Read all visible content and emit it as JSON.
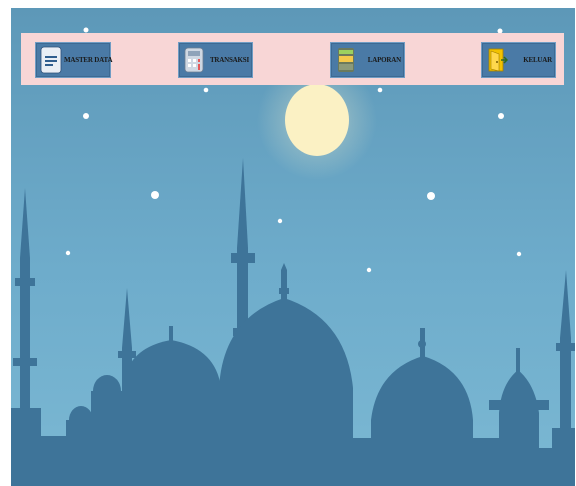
{
  "menu": {
    "master_data_label": "MASTER DATA",
    "transaksi_label": "TRANSAKSI",
    "laporan_label": "LAPORAN",
    "keluar_label": "KELUAR"
  },
  "icons": {
    "master_data": "document-icon",
    "transaksi": "calculator-icon",
    "laporan": "report-box-icon",
    "keluar": "exit-door-icon"
  },
  "colors": {
    "sky_top": "#5e9ab9",
    "sky_bottom": "#7ab6d0",
    "silhouette": "#3e7499",
    "menu_bar_bg": "#f8d6d6",
    "button_bg": "#4a7aa6",
    "moon": "#fbf1c4"
  }
}
